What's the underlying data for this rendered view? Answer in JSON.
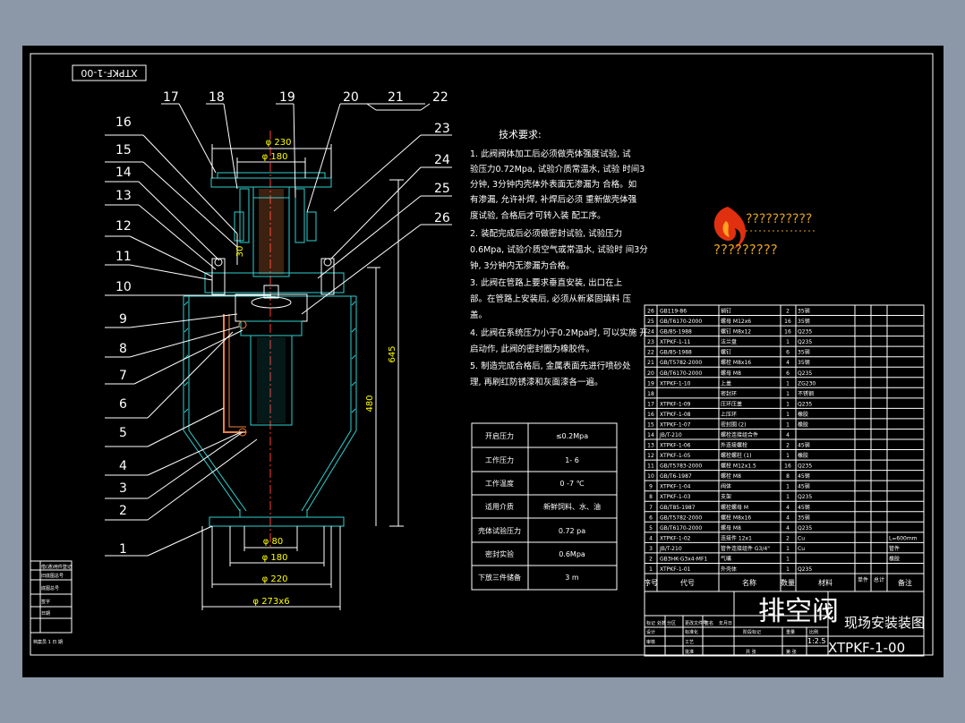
{
  "drawing_code_rotated": "XTPKF-1-00",
  "leader_numbers": [
    "17",
    "18",
    "19",
    "20",
    "21",
    "22",
    "16",
    "15",
    "14",
    "13",
    "12",
    "11",
    "10",
    "9",
    "8",
    "7",
    "6",
    "5",
    "4",
    "3",
    "2",
    "1",
    "23",
    "24",
    "25",
    "26"
  ],
  "dimensions": {
    "d_top_outer": "φ 230",
    "d_top_inner": "φ 180",
    "d_bottom_inner": "φ 80",
    "d_bottom_mid": "φ 180",
    "d_bottom_outer": "φ 220",
    "d_bottom_flange": "φ 273x6",
    "h_total": "645",
    "h_inner": "480",
    "h_small": "30"
  },
  "tech_requirements": {
    "title": "技术要求:",
    "lines": [
      "1. 此阀阀体加工后必须做壳体强度试验, 试",
      "验压力0.72Mpa, 试验介质常温水, 试验   时间3",
      "分钟, 3分钟内壳体外表面无渗漏为     合格。如",
      "有渗漏, 允许补焊, 补焊后必须     重新做壳体强",
      "度试验, 合格后才可转入装     配工序。",
      "2. 装配完成后必须做密封试验, 试验压力",
      "0.6Mpa, 试验介质空气或常温水, 试验时   间3分",
      "钟, 3分钟内无渗漏为合格。",
      "3. 此阀在管路上要求垂直安装, 出口在上",
      "部。在管路上安装后, 必须从新紧固填料     压",
      "盖。",
      "4. 此阀在系统压力小于0.2Mpa时, 可以实施     开",
      "启动作, 此阀的密封圈为橡胶件。",
      "5. 制造完成合格后, 金属表面先进行喷砂处",
      "理, 再刷红防锈漆和灰面漆各一遍。"
    ]
  },
  "param_table": [
    {
      "k": "开启压力",
      "v": "≤0.2Mpa"
    },
    {
      "k": "工作压力",
      "v": "1-  6"
    },
    {
      "k": "工作温度",
      "v": "0 -7 ℃"
    },
    {
      "k": "适用介质",
      "v": "新鲜饲料、水、油"
    },
    {
      "k": "壳体试验压力",
      "v": "0.72  pa"
    },
    {
      "k": "密封实验",
      "v": "0.6Mpa"
    },
    {
      "k": "下放三件储备",
      "v": "3    m"
    }
  ],
  "logo_text_1": "??????????",
  "logo_text_2": "?????????",
  "bom_header": [
    "序号",
    "代号",
    "名称",
    "数量",
    "材料",
    "单件",
    "总计",
    "备注"
  ],
  "bom_rows": [
    [
      "26",
      "GB119-86",
      "销钉",
      "2",
      "35钢",
      ""
    ],
    [
      "25",
      "GB/T6170-2000",
      "螺母 M12x6",
      "16",
      "35钢",
      ""
    ],
    [
      "24",
      "GB/85-1988",
      "螺钉 M8x12",
      "16",
      "Q235",
      ""
    ],
    [
      "23",
      "XTPKF-1-11",
      "法兰盘",
      "1",
      "Q235",
      ""
    ],
    [
      "22",
      "GB/85-1988",
      "螺钉",
      "6",
      "35钢",
      ""
    ],
    [
      "21",
      "GB/T5782-2000",
      "螺栓 M8x16",
      "4",
      "35钢",
      ""
    ],
    [
      "20",
      "GB/T6170-2000",
      "螺母 M8",
      "6",
      "Q235",
      ""
    ],
    [
      "19",
      "XTPKF-1-10",
      "上盖",
      "1",
      "ZG230",
      ""
    ],
    [
      "18",
      "",
      "密封环",
      "1",
      "不锈钢",
      ""
    ],
    [
      "17",
      "XTPKF-1-09",
      "压环压盖",
      "1",
      "Q235",
      ""
    ],
    [
      "16",
      "XTPKF-1-08",
      "上压环",
      "1",
      "橡胶",
      ""
    ],
    [
      "15",
      "XTPKF-1-07",
      "密封圈 (2)",
      "1",
      "橡胶",
      ""
    ],
    [
      "14",
      "JB/T-210",
      "螺栓连接组合件",
      "4",
      "",
      ""
    ],
    [
      "13",
      "XTPKF-1-06",
      "外连接螺栓",
      "2",
      "45钢",
      ""
    ],
    [
      "12",
      "XTPKF-1-05",
      "螺栓螺柱 (1)",
      "1",
      "橡胶",
      ""
    ],
    [
      "11",
      "GB/T5783-2000",
      "螺栓 M12x1.5",
      "16",
      "Q235",
      ""
    ],
    [
      "10",
      "GB/T6-1987",
      "螺栓 M8",
      "8",
      "45钢",
      ""
    ],
    [
      "9",
      "XTPKF-1-04",
      "阀体",
      "1",
      "45钢",
      ""
    ],
    [
      "8",
      "XTPKF-1-03",
      "支架",
      "1",
      "Q235",
      ""
    ],
    [
      "7",
      "GB/T85-1987",
      "螺栓螺母 M",
      "4",
      "45钢",
      ""
    ],
    [
      "6",
      "GB/T5782-2000",
      "螺栓 M8x16",
      "4",
      "35钢",
      ""
    ],
    [
      "5",
      "GB/T6170-2000",
      "螺母 M8",
      "4",
      "Q235",
      ""
    ],
    [
      "4",
      "XTPKF-1-02",
      "连接件  12x1",
      "2",
      "Cu",
      "L=600mm"
    ],
    [
      "3",
      "JB/T-210",
      "管件连接组件  G3/4\"",
      "1",
      "Cu",
      "管件"
    ],
    [
      "2",
      "GB3HK-G3x4-MF1",
      "气嘴",
      "1",
      "",
      "橡胶"
    ],
    [
      "1",
      "XTPKF-1-01",
      "外壳体",
      "1",
      "Q235",
      ""
    ]
  ],
  "title_block": {
    "main_title": "排空阀",
    "sub_title": "现场安装装图",
    "drawing_no": "XTPKF-1-00",
    "scale": "1:2.5",
    "small_labels": [
      "标记",
      "处数",
      "分区",
      "更改文件号",
      "签名",
      "年月日",
      "设计",
      "标准化",
      "审核",
      "工艺",
      "批准",
      "阶段标记",
      "重量",
      "比例",
      "共 张",
      "第 张"
    ]
  },
  "left_strip": [
    "借(通)用件登记",
    "旧底图总号",
    "底图总号",
    "签字",
    "日期",
    "档案员 1 日 期"
  ]
}
